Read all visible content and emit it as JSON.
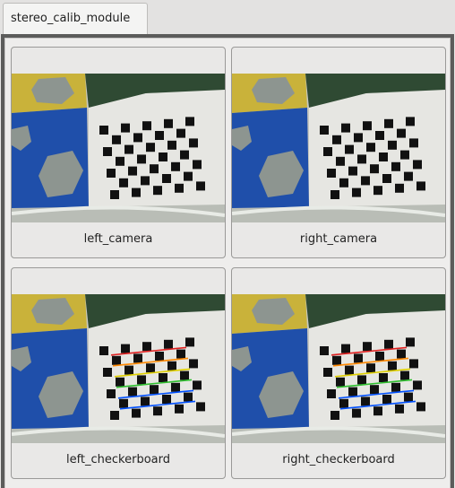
{
  "tab": {
    "title": "stereo_calib_module"
  },
  "panels": [
    {
      "label": "left_camera",
      "overlay": false
    },
    {
      "label": "right_camera",
      "overlay": false
    },
    {
      "label": "left_checkerboard",
      "overlay": true
    },
    {
      "label": "right_checkerboard",
      "overlay": true
    }
  ],
  "colors": {
    "frame": "#5c5c5b",
    "panel_bg": "#e9e8e7",
    "tab_bg": "#f4f4f3",
    "overlay_rows": [
      "#e02020",
      "#ff8800",
      "#e0d000",
      "#30c030",
      "#0050ff"
    ]
  }
}
